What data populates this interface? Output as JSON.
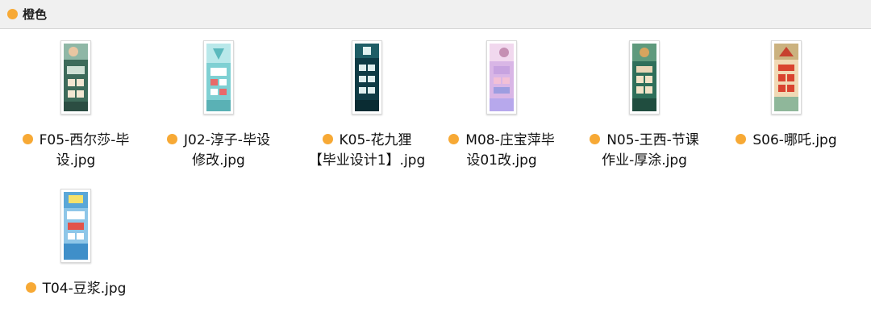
{
  "header": {
    "title": "橙色",
    "tag_color": "#f7a935"
  },
  "files": [
    {
      "line1": "F05-西尔莎-毕",
      "line2": "设.jpg",
      "thumb": "thumb-garden"
    },
    {
      "line1": "J02-淳子-毕设",
      "line2": "修改.jpg",
      "thumb": "thumb-aqua"
    },
    {
      "line1": "K05-花九狸",
      "line2": "【毕业设计1】.jpg",
      "thumb": "thumb-dark"
    },
    {
      "line1": "M08-庄宝萍毕",
      "line2": "设01改.jpg",
      "thumb": "thumb-pink"
    },
    {
      "line1": "N05-王西-节课",
      "line2": "作业-厚涂.jpg",
      "thumb": "thumb-forest"
    },
    {
      "line1": "S06-哪吒.jpg",
      "line2": "",
      "thumb": "thumb-red"
    },
    {
      "line1": "T04-豆浆.jpg",
      "line2": "",
      "thumb": "thumb-blue"
    }
  ]
}
